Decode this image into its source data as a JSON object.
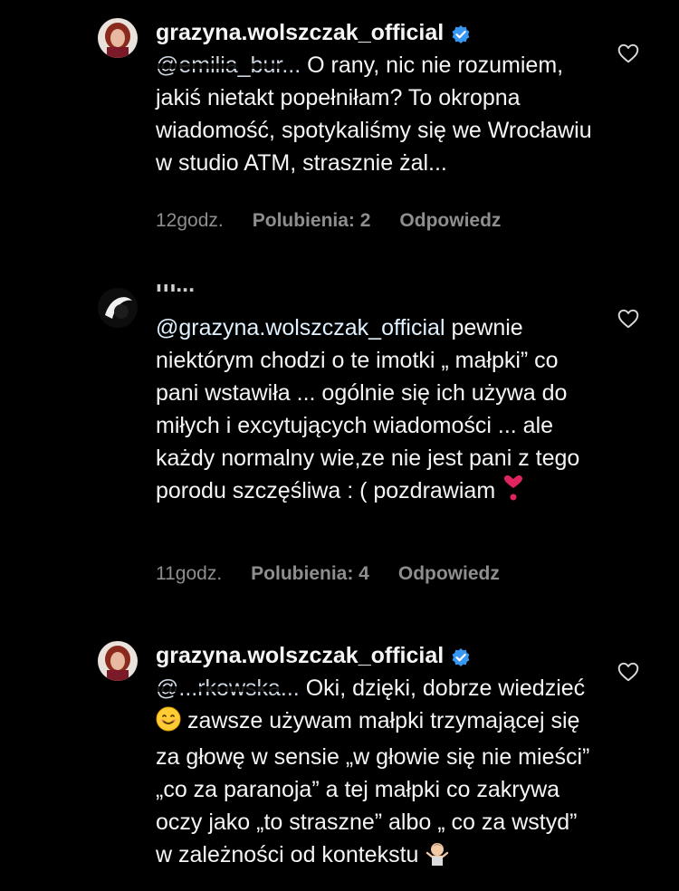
{
  "comments": [
    {
      "username": "grazyna.wolszczak_official",
      "verified": true,
      "mention": "@emilia_bur...",
      "text": "O rany, nic nie rozumiem, jakiś nietakt popełniłam? To okropna wiadomość, spotykaliśmy się we Wrocławiu w studio ATM, strasznie żal...",
      "time": "12godz.",
      "likes": "Polubienia: 2",
      "reply": "Odpowiedz"
    },
    {
      "username": "m...",
      "verified": false,
      "mention": "@grazyna.wolszczak_official",
      "text_part1": "pewnie niektórym chodzi o te imotki „ małpki” co pani wstawiła ... ogólnie się ich  używa do miłych i excytujących wiadomości ... ale każdy normalny wie,ze nie jest pani z tego porodu szczęśliwa : ( pozdrawiam",
      "time": "11godz.",
      "likes": "Polubienia: 4",
      "reply": "Odpowiedz"
    },
    {
      "username": "grazyna.wolszczak_official",
      "verified": true,
      "mention": "@...rkowska...",
      "text_part1": "Oki, dzięki, dobrze wiedzieć",
      "text_part2": "zawsze używam małpki trzymającej  się za głowę w sensie „w głowie się nie mieści” „co za paranoja” a tej małpki co zakrywa oczy jako „to straszne” albo „ co za wstyd” w zależności od kontekstu"
    }
  ],
  "colors": {
    "background": "#000000",
    "text": "#f5f5f5",
    "meta": "#8e8e8e",
    "verified": "#3897f0",
    "heart_emoji": "#e0245e"
  },
  "icons": {
    "like": "heart-outline-icon",
    "verified": "verified-badge-icon"
  }
}
